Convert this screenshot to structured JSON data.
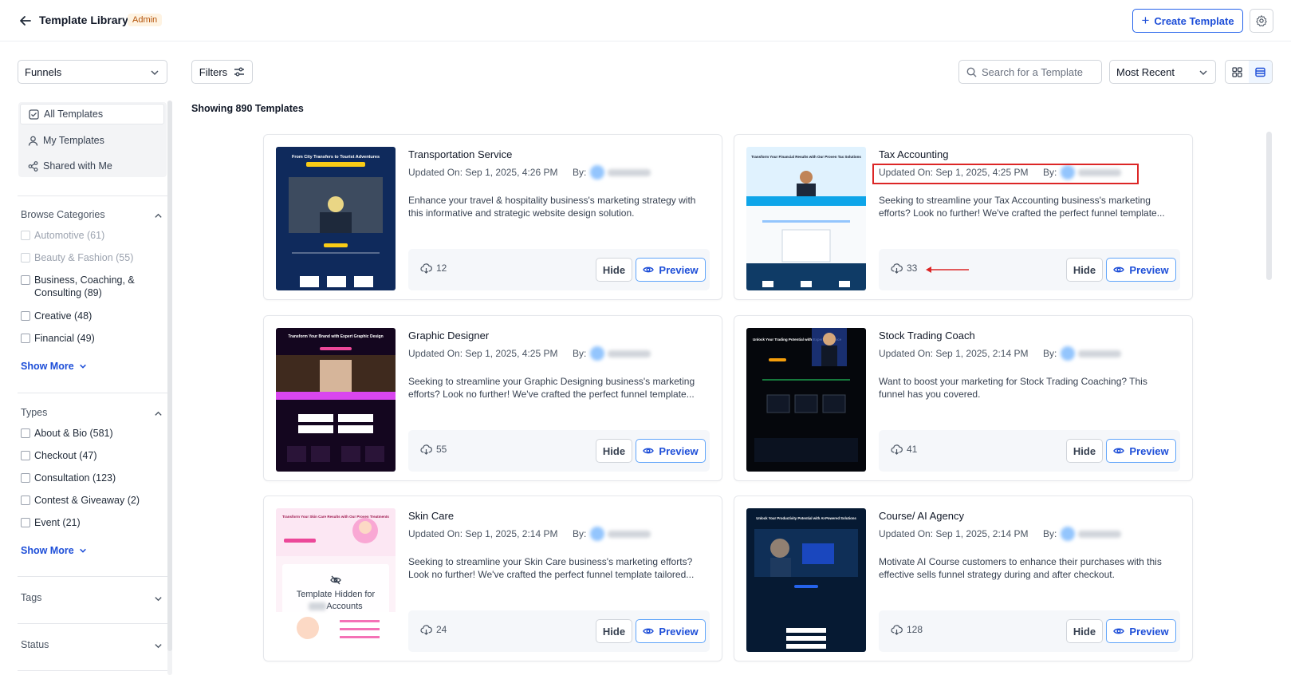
{
  "header": {
    "title": "Template Library",
    "badge": "Admin",
    "create_label": "Create Template"
  },
  "toolbar": {
    "category_select": "Funnels",
    "filters_label": "Filters",
    "search_placeholder": "Search for a Template",
    "sort_select": "Most Recent",
    "showing_text": "Showing 890 Templates"
  },
  "sidebar": {
    "nav": [
      {
        "label": "All Templates",
        "icon": "checkbox-icon"
      },
      {
        "label": "My Templates",
        "icon": "user-icon"
      },
      {
        "label": "Shared with Me",
        "icon": "share-icon"
      }
    ],
    "categories": {
      "heading": "Browse Categories",
      "items": [
        "Automotive (61)",
        "Beauty & Fashion (55)",
        "Business, Coaching, & Consulting (89)",
        "Creative (48)",
        "Financial (49)"
      ],
      "show_more": "Show More"
    },
    "types": {
      "heading": "Types",
      "items": [
        "About & Bio (581)",
        "Checkout (47)",
        "Consultation (123)",
        "Contest & Giveaway (2)",
        "Event (21)"
      ],
      "show_more": "Show More"
    },
    "tags_heading": "Tags",
    "status_heading": "Status"
  },
  "card_labels": {
    "by": "By:",
    "hide": "Hide",
    "preview": "Preview"
  },
  "templates": [
    {
      "title": "Transportation Service",
      "updated": "Updated On: Sep 1, 2025, 4:26 PM",
      "description": "Enhance your travel & hospitality business's marketing strategy with this informative and strategic website design solution.",
      "downloads": "12",
      "thumb_heading": "From City Transfers to Tourist Adventures"
    },
    {
      "title": "Tax Accounting",
      "updated": "Updated On: Sep 1, 2025, 4:25 PM",
      "description": "Seeking to streamline your Tax Accounting business's marketing efforts? Look no further! We've crafted the perfect funnel template...",
      "downloads": "33",
      "thumb_heading": "Transform Your Financial Results with Our Proven Tax Solutions"
    },
    {
      "title": "Graphic Designer",
      "updated": "Updated On: Sep 1, 2025, 4:25 PM",
      "description": "Seeking to streamline your Graphic Designing business's marketing efforts? Look no further! We've crafted the perfect funnel template...",
      "downloads": "55",
      "thumb_heading": "Transform Your Brand with Expert Graphic Design"
    },
    {
      "title": "Stock Trading Coach",
      "updated": "Updated On: Sep 1, 2025, 2:14 PM",
      "description": "Want to boost your marketing for Stock Trading Coaching? This funnel has you covered.",
      "downloads": "41",
      "thumb_heading": "Unlock Your Trading Potential with Expert Guidance"
    },
    {
      "title": "Skin Care",
      "updated": "Updated On: Sep 1, 2025, 2:14 PM",
      "description": "Seeking to streamline your Skin Care business's marketing efforts? Look no further! We've crafted the perfect funnel template tailored...",
      "downloads": "24",
      "thumb_heading": "Transform Your Skin Care Results with Our Proven Treatments",
      "hidden_note": "Template Hidden for",
      "hidden_note_2": "Accounts"
    },
    {
      "title": "Course/ AI Agency",
      "updated": "Updated On: Sep 1, 2025, 2:14 PM",
      "description": "Motivate AI Course customers to enhance their purchases with this effective sells funnel strategy during and after checkout.",
      "downloads": "128",
      "thumb_heading": "Unlock Your Productivity Potential with AI-Powered Solutions"
    }
  ],
  "colors": {
    "primary": "#1d4ed8",
    "annotation": "#dc2626",
    "badge_text": "#b45309",
    "badge_bg": "#fef3e2"
  }
}
